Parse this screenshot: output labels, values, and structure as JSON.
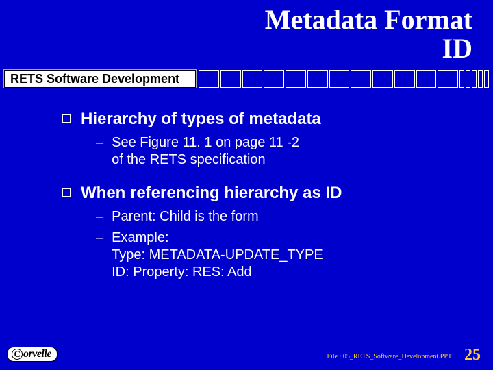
{
  "title_line1": "Metadata Format",
  "title_line2": "ID",
  "subtitle": "RETS Software Development",
  "bullets": {
    "b1": {
      "heading": "Hierarchy of types of metadata",
      "sub": "See Figure 11. 1 on page 11 -2\nof the RETS specification"
    },
    "b2": {
      "heading": "When referencing hierarchy as ID",
      "sub1": "Parent: Child is the form",
      "sub2": "Example:\nType: METADATA-UPDATE_TYPE\nID: Property: RES: Add"
    }
  },
  "logo_text": "orvelle",
  "footer_file": "File : 05_RETS_Software_Development.PPT",
  "page_number": "25",
  "dash": "–"
}
